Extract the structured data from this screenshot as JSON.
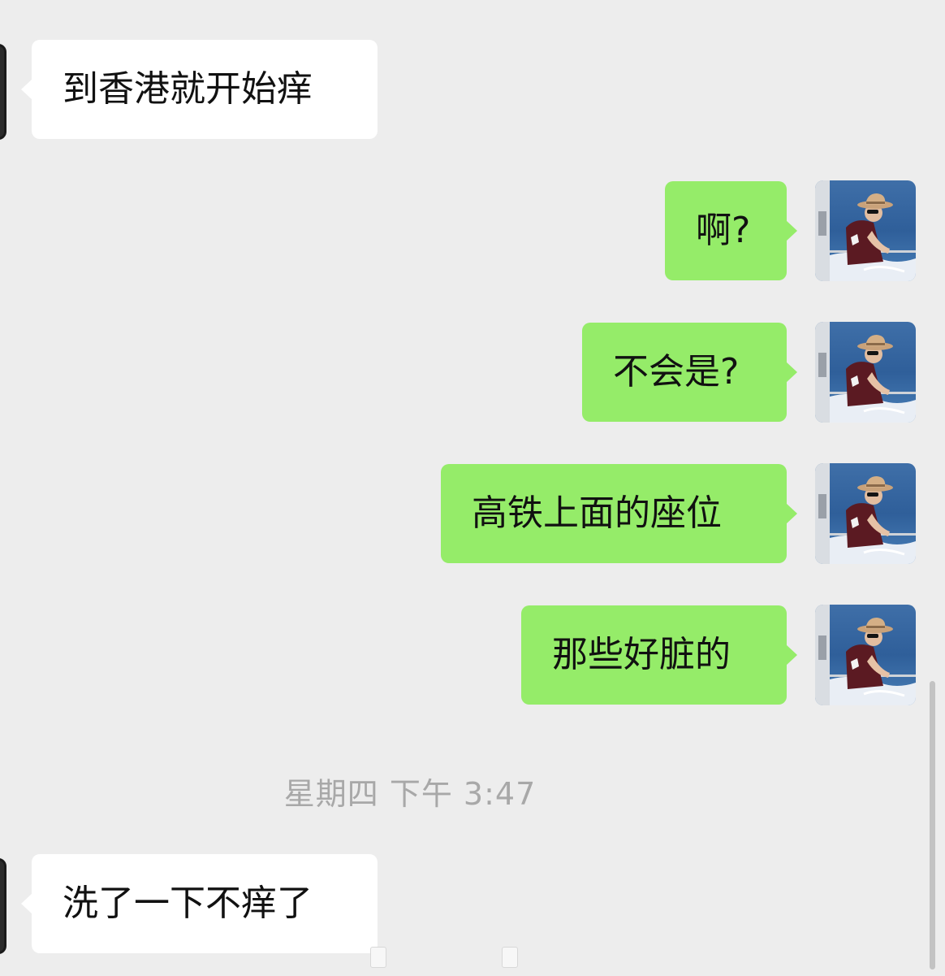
{
  "chat": {
    "messages": [
      {
        "direction": "incoming",
        "text": "到香港就开始痒"
      },
      {
        "direction": "outgoing",
        "text": "啊?"
      },
      {
        "direction": "outgoing",
        "text": "不会是?"
      },
      {
        "direction": "outgoing",
        "text": "高铁上面的座位"
      },
      {
        "direction": "outgoing",
        "text": "那些好脏的"
      },
      {
        "direction": "incoming",
        "text": "洗了一下不痒了"
      }
    ],
    "timestamp": "星期四 下午 3:47"
  },
  "colors": {
    "background": "#ededed",
    "incoming_bubble": "#ffffff",
    "outgoing_bubble": "#95ec69",
    "text": "#111111",
    "timestamp_text": "#a8a8a8"
  },
  "icons": {
    "avatar": "avatar-photo-ocean"
  }
}
